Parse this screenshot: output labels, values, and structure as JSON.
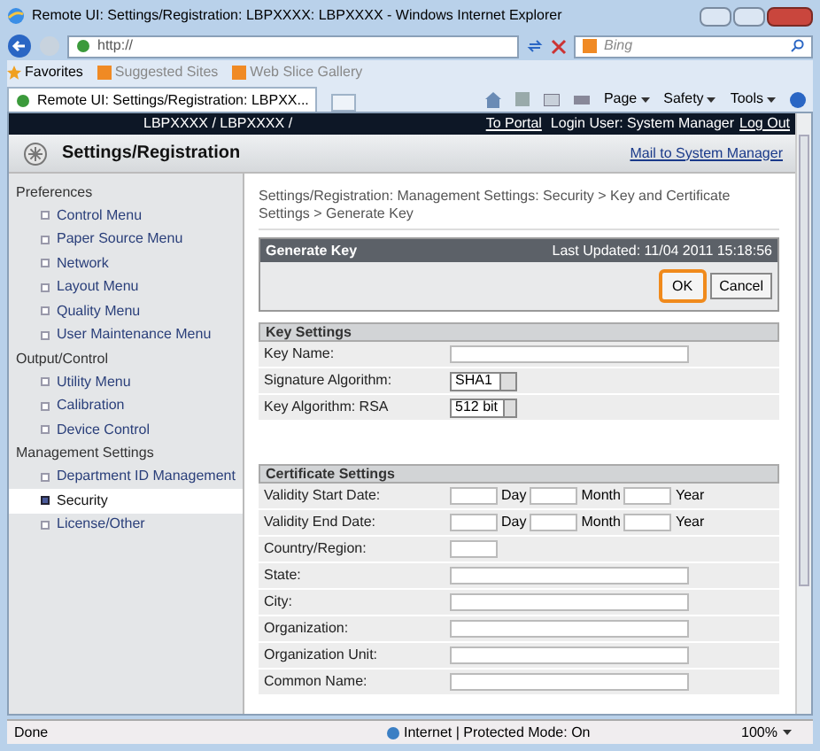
{
  "window": {
    "title": "Remote UI: Settings/Registration: LBPXXXX: LBPXXXX - Windows Internet Explorer"
  },
  "browser": {
    "address": "http://",
    "search_placeholder": "Bing",
    "favorites": [
      "Favorites",
      "Suggested Sites",
      "Web Slice Gallery"
    ],
    "tab": "Remote UI: Settings/Registration: LBPXX...",
    "commands": [
      "Page",
      "Safety",
      "Tools"
    ]
  },
  "header": {
    "device": "LBPXXXX / LBPXXXX /",
    "portal_link": "To Portal",
    "login": "Login User: System Manager",
    "logout_link": "Log Out"
  },
  "title_bar": {
    "title": "Settings/Registration",
    "mail_link": "Mail to System Manager"
  },
  "sidebar": [
    {
      "heading": "Preferences",
      "items": [
        {
          "label": "Control Menu",
          "selected": false
        },
        {
          "label": "Paper Source Menu",
          "selected": false
        },
        {
          "label": "Network",
          "selected": false
        },
        {
          "label": "Layout Menu",
          "selected": false
        },
        {
          "label": "Quality Menu",
          "selected": false
        },
        {
          "label": "User Maintenance Menu",
          "selected": false
        }
      ]
    },
    {
      "heading": "Output/Control",
      "items": [
        {
          "label": "Utility Menu",
          "selected": false
        },
        {
          "label": "Calibration",
          "selected": false
        },
        {
          "label": "Device Control",
          "selected": false
        }
      ]
    },
    {
      "heading": "Management Settings",
      "items": [
        {
          "label": "Department ID Management",
          "selected": false
        },
        {
          "label": "Security",
          "selected": true
        },
        {
          "label": "License/Other",
          "selected": false
        }
      ]
    }
  ],
  "breadcrumb": "Settings/Registration: Management Settings: Security > Key and Certificate Settings > Generate Key",
  "panel": {
    "title": "Generate Key",
    "last_updated": "Last Updated: 11/04 2011 15:18:56",
    "buttons": [
      {
        "label": "OK",
        "highlighted": true
      },
      {
        "label": "Cancel",
        "highlighted": false
      }
    ]
  },
  "sections": [
    {
      "title": "Key Settings",
      "rows": [
        {
          "kind": "text",
          "label": "Key Name:"
        },
        {
          "kind": "select",
          "label": "Signature Algorithm:",
          "value": "SHA1"
        },
        {
          "kind": "select",
          "label": "Key Algorithm: RSA",
          "value": "512 bit"
        }
      ]
    },
    {
      "title": "Certificate Settings",
      "rows": [
        {
          "kind": "date",
          "label": "Validity Start Date:",
          "parts": [
            "Day",
            "Month",
            "Year"
          ]
        },
        {
          "kind": "date",
          "label": "Validity End Date:",
          "parts": [
            "Day",
            "Month",
            "Year"
          ]
        },
        {
          "kind": "short",
          "label": "Country/Region:"
        },
        {
          "kind": "text",
          "label": "State:"
        },
        {
          "kind": "text",
          "label": "City:"
        },
        {
          "kind": "text",
          "label": "Organization:"
        },
        {
          "kind": "text",
          "label": "Organization Unit:"
        },
        {
          "kind": "text",
          "label": "Common Name:"
        }
      ]
    }
  ],
  "status_bar": {
    "text": "Done",
    "zone": "Internet | Protected Mode: On",
    "zoom": "100%"
  }
}
